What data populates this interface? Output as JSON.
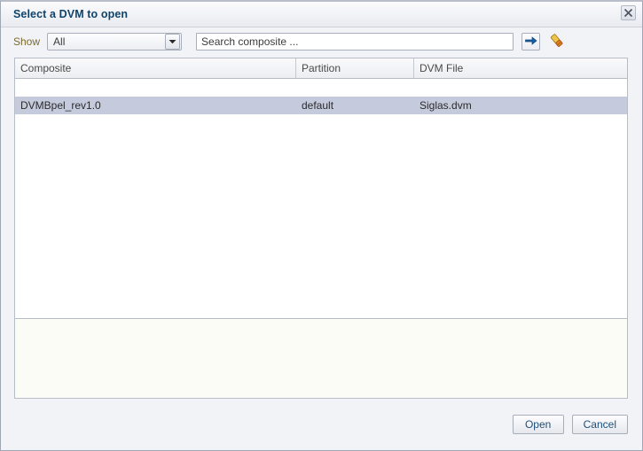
{
  "dialog": {
    "title": "Select a DVM to open",
    "close_icon": "close-icon"
  },
  "toolbar": {
    "show_label": "Show",
    "filter_value": "All",
    "filter_options": [
      "All"
    ],
    "search_placeholder": "Search composite ...",
    "search_value": "",
    "go_icon": "arrow-right-icon",
    "clear_icon": "eraser-icon"
  },
  "table": {
    "columns": [
      "Composite",
      "Partition",
      "DVM File"
    ],
    "rows": [
      {
        "composite": "",
        "partition": "",
        "dvm_file": "",
        "selected": false
      },
      {
        "composite": "DVMBpel_rev1.0",
        "partition": "default",
        "dvm_file": "Siglas.dvm",
        "selected": true
      }
    ]
  },
  "footer": {
    "open_label": "Open",
    "cancel_label": "Cancel"
  },
  "colors": {
    "title_blue": "#10436b",
    "show_label_olive": "#7a6a2e",
    "selection_blue": "#c5cadc",
    "button_text_blue": "#1d4f7c",
    "go_arrow_blue": "#1a5fa8",
    "eraser_orange": "#e08a22"
  }
}
